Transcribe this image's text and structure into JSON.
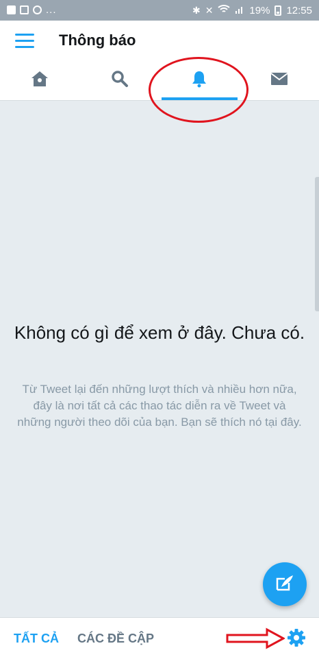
{
  "status_bar": {
    "dots": "...",
    "battery_percent": "19%",
    "time": "12:55"
  },
  "header": {
    "title": "Thông báo",
    "menu_icon": "hamburger-menu-icon"
  },
  "tabs": [
    {
      "name": "home",
      "icon": "home-icon",
      "active": false
    },
    {
      "name": "search",
      "icon": "search-icon",
      "active": false
    },
    {
      "name": "notifications",
      "icon": "bell-icon",
      "active": true
    },
    {
      "name": "messages",
      "icon": "envelope-icon",
      "active": false
    }
  ],
  "empty_state": {
    "title": "Không có gì để xem ở đây. Chưa có.",
    "body": "Từ Tweet lại đến những lượt thích và nhiều hơn nữa, đây là nơi tất cả các thao tác diễn ra về Tweet và những người theo dõi của bạn. Bạn sẽ thích nó tại đây."
  },
  "fab": {
    "icon": "compose-tweet-icon"
  },
  "bottom_bar": {
    "all_label": "TẤT CẢ",
    "mentions_label": "CÁC ĐỀ CẬP",
    "settings_icon": "gear-icon"
  },
  "colors": {
    "accent": "#1da1f2",
    "background": "#e6ecf0",
    "annotation_red": "#e0141e"
  }
}
